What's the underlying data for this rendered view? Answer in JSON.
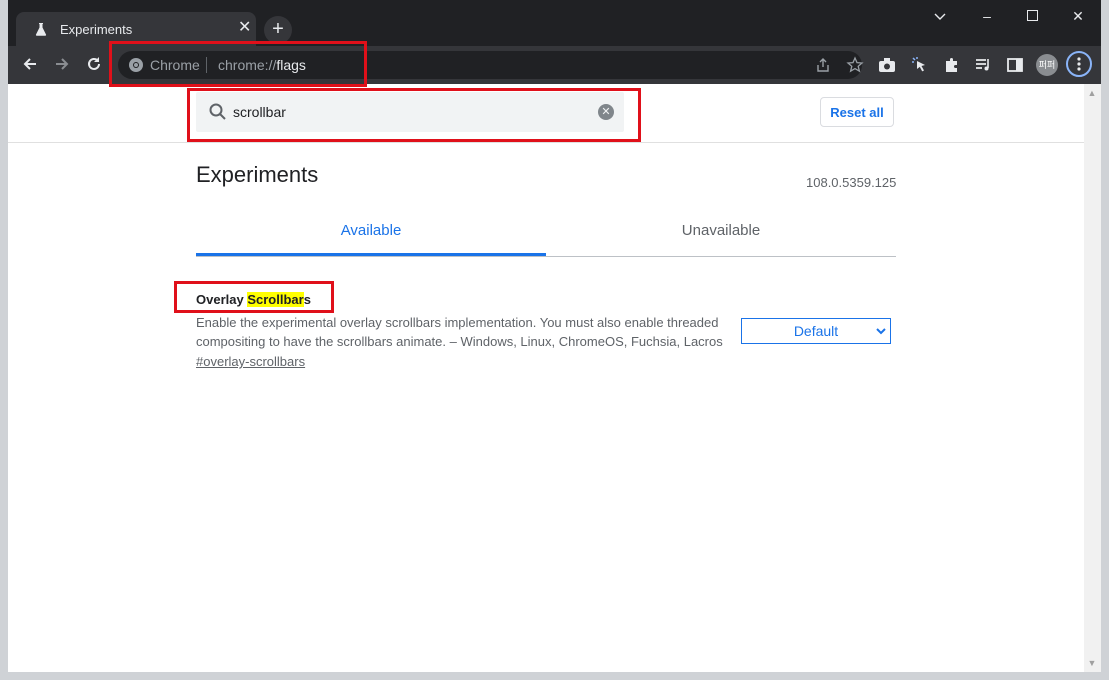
{
  "tab": {
    "title": "Experiments",
    "close": "✕",
    "new_tab": "+"
  },
  "window_controls": {
    "minimize": "–",
    "maximize": "☐",
    "close": "✕",
    "dropdown": "⌄"
  },
  "omnibox": {
    "site_label": "Chrome",
    "url_prefix": "chrome://",
    "url_path": "flags"
  },
  "avatar_text": "퍼퍼",
  "search": {
    "value": "scrollbar"
  },
  "reset_label": "Reset all",
  "page_title": "Experiments",
  "version": "108.0.5359.125",
  "tabs": {
    "available": "Available",
    "unavailable": "Unavailable"
  },
  "experiment": {
    "title_pre": "Overlay ",
    "title_highlight": "Scrollbar",
    "title_post": "s",
    "description": "Enable the experimental overlay scrollbars implementation. You must also enable threaded compositing to have the scrollbars animate. – Windows, Linux, ChromeOS, Fuchsia, Lacros",
    "link": "#overlay-scrollbars",
    "select_value": "Default"
  },
  "icons": {
    "tab": "flask-icon",
    "back": "back-arrow-icon",
    "forward": "forward-arrow-icon",
    "reload": "reload-icon",
    "share": "share-icon",
    "bookmark": "star-icon",
    "screenshot": "camera-icon",
    "cursor": "cursor-click-icon",
    "extensions": "puzzle-icon",
    "media": "media-queue-icon",
    "sidepanel": "side-panel-icon",
    "search": "search-icon",
    "clear": "clear-icon"
  },
  "colors": {
    "accent": "#1a73e8",
    "annotation": "#e0101a",
    "highlight": "#ffff00"
  }
}
